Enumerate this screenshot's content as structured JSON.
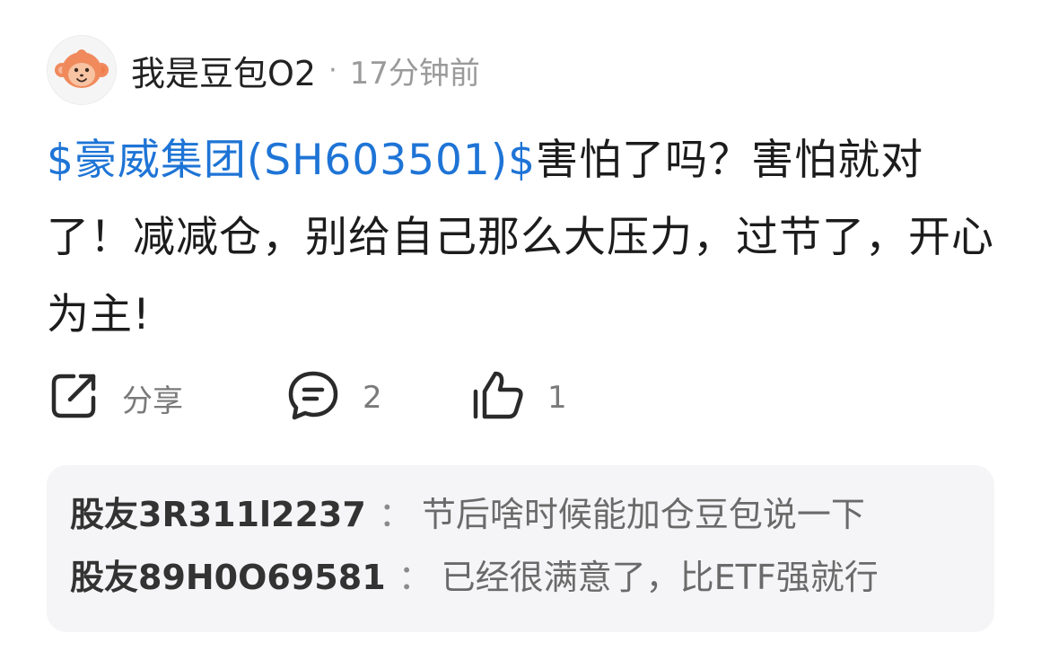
{
  "post": {
    "username": "我是豆包O2",
    "separator": "·",
    "time": "17分钟前",
    "avatar_icon": "monkey-avatar-icon",
    "content": {
      "stock_link": "$豪威集团(SH603501)$",
      "text": "害怕了吗？害怕就对了！减减仓，别给自己那么大压力，过节了，开心为主!"
    },
    "link_color": "#1e74d6"
  },
  "actions": {
    "share": {
      "icon": "share-icon",
      "label": "分享"
    },
    "comment": {
      "icon": "comment-icon",
      "count": "2"
    },
    "like": {
      "icon": "thumbs-up-icon",
      "count": "1"
    }
  },
  "comments": [
    {
      "author": "股友3R311l2237",
      "separator": "：",
      "text": "节后啥时候能加仓豆包说一下"
    },
    {
      "author": "股友89H0O69581",
      "separator": "：",
      "text": "已经很满意了，比ETF强就行"
    }
  ]
}
